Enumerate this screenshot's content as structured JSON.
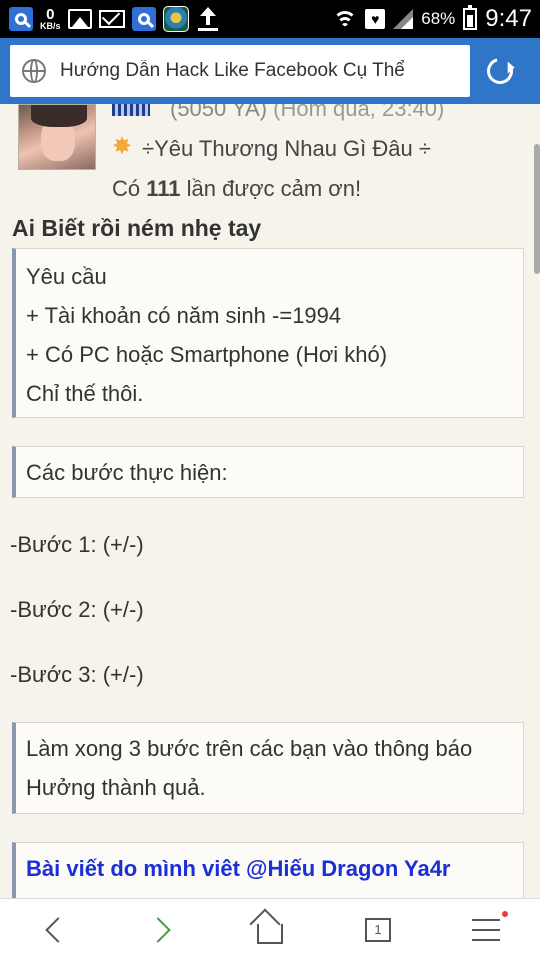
{
  "status_bar": {
    "kb_value": "0",
    "kb_unit": "KB/s",
    "battery_percent": "68%",
    "time": "9:47"
  },
  "browser": {
    "page_title": "Hướng Dẫn Hack Like Facebook Cụ Thể"
  },
  "post": {
    "author_meta": "(5050 YA)",
    "timestamp": "(Hôm qua, 23:40)",
    "rank": "÷Yêu Thương Nhau Gì Đâu ÷",
    "thanks_prefix": "Có",
    "thanks_count": "111",
    "thanks_suffix": "lần được cảm ơn!",
    "title": "Ai Biết rồi ném nhẹ tay",
    "requirements": {
      "heading": "Yêu cầu",
      "line1": "+ Tài khoản có năm sinh -=1994",
      "line2": "+ Có PC hoặc Smartphone (Hơi khó)",
      "line3": "Chỉ thế thôi."
    },
    "steps_heading": "Các bước thực hiện:",
    "steps": [
      "-Bước 1: (+/-)",
      "-Bước 2: (+/-)",
      "-Bước 3: (+/-)"
    ],
    "done_text": "Làm xong 3 bước trên các bạn vào thông báo Hưởng thành quả.",
    "author_note": "Bài viết do mình viêt @Hiếu Dragon Ya4r"
  },
  "bottom_nav": {
    "tab_count": "1"
  }
}
